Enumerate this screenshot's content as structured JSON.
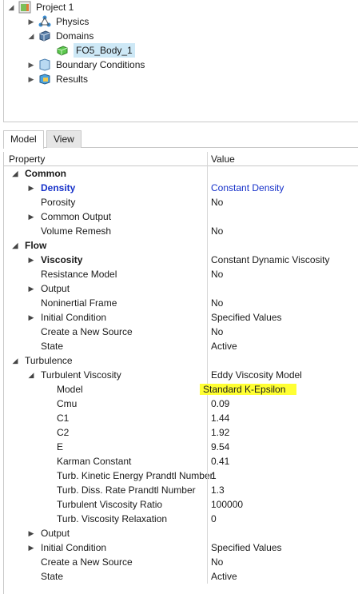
{
  "tree": {
    "project": "Project 1",
    "physics": "Physics",
    "domains": "Domains",
    "body": "FO5_Body_1",
    "boundary": "Boundary Conditions",
    "results": "Results"
  },
  "tabs": {
    "model": "Model",
    "view": "View"
  },
  "grid": {
    "header_property": "Property",
    "header_value": "Value",
    "rows": [
      {
        "p": "Common",
        "v": ""
      },
      {
        "p": "Density",
        "v": "Constant Density"
      },
      {
        "p": "Porosity",
        "v": "No"
      },
      {
        "p": "Common Output",
        "v": ""
      },
      {
        "p": "Volume Remesh",
        "v": "No"
      },
      {
        "p": "Flow",
        "v": ""
      },
      {
        "p": "Viscosity",
        "v": "Constant Dynamic Viscosity"
      },
      {
        "p": "Resistance Model",
        "v": "No"
      },
      {
        "p": "Output",
        "v": ""
      },
      {
        "p": "Noninertial Frame",
        "v": "No"
      },
      {
        "p": "Initial Condition",
        "v": "Specified Values"
      },
      {
        "p": "Create a New Source",
        "v": "No"
      },
      {
        "p": "State",
        "v": "Active"
      },
      {
        "p": "Turbulence",
        "v": ""
      },
      {
        "p": "Turbulent Viscosity",
        "v": "Eddy Viscosity Model"
      },
      {
        "p": "Model",
        "v": "Standard K-Epsilon"
      },
      {
        "p": "Cmu",
        "v": "0.09"
      },
      {
        "p": "C1",
        "v": "1.44"
      },
      {
        "p": "C2",
        "v": "1.92"
      },
      {
        "p": "E",
        "v": "9.54"
      },
      {
        "p": "Karman Constant",
        "v": "0.41"
      },
      {
        "p": "Turb. Kinetic Energy Prandtl Number",
        "v": "1"
      },
      {
        "p": "Turb. Diss. Rate Prandtl Number",
        "v": "1.3"
      },
      {
        "p": "Turbulent Viscosity Ratio",
        "v": "100000"
      },
      {
        "p": "Turb. Viscosity Relaxation",
        "v": "0"
      },
      {
        "p": "Output",
        "v": ""
      },
      {
        "p": "Initial Condition",
        "v": "Specified Values"
      },
      {
        "p": "Create a New Source",
        "v": "No"
      },
      {
        "p": "State",
        "v": "Active"
      }
    ]
  },
  "colors": {
    "link": "#1530c9",
    "highlight": "#ffff33",
    "selection": "#cde8f6"
  }
}
